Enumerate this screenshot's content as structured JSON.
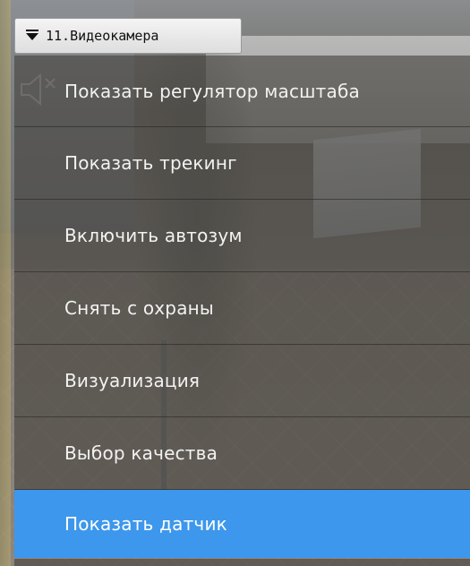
{
  "camera": {
    "title": "11.Видеокамера"
  },
  "icons": {
    "camera_menu_toggle": "caret-down-icon",
    "sound": "speaker-muted-icon"
  },
  "colors": {
    "active_item_bg": "#3d97ec",
    "menu_text": "#f2f2f2"
  },
  "menu": {
    "items": [
      {
        "label": "Показать регулятор масштаба",
        "active": false
      },
      {
        "label": "Показать трекинг",
        "active": false
      },
      {
        "label": "Включить автозум",
        "active": false
      },
      {
        "label": "Снять с охраны",
        "active": false
      },
      {
        "label": "Визуализация",
        "active": false
      },
      {
        "label": "Выбор качества",
        "active": false
      },
      {
        "label": "Показать датчик",
        "active": true
      }
    ]
  }
}
